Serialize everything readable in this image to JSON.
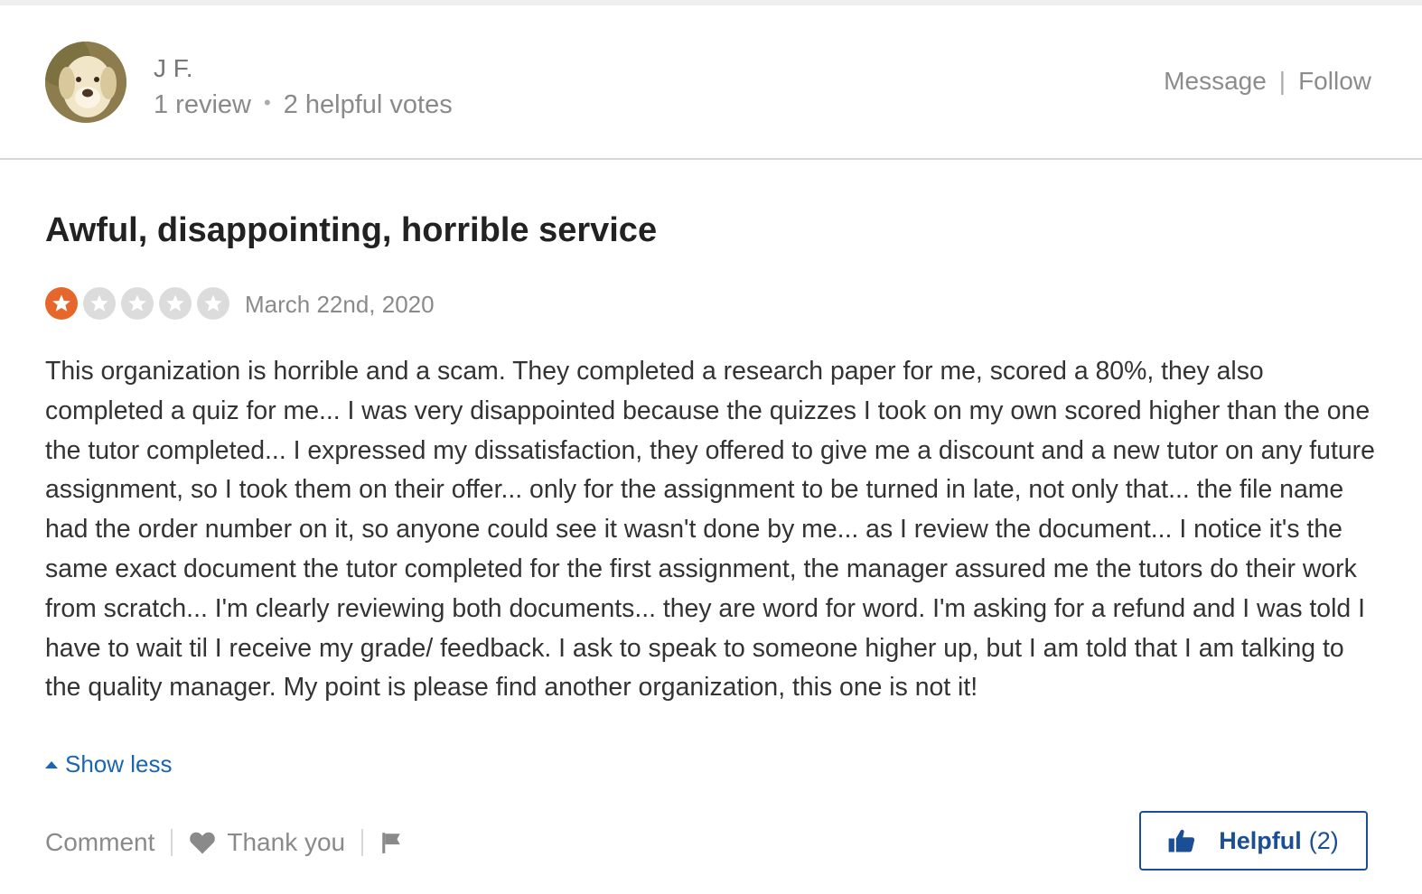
{
  "profile": {
    "name": "J F.",
    "review_count": "1 review",
    "helpful_votes": "2 helpful votes",
    "message_label": "Message",
    "separator": "|",
    "follow_label": "Follow"
  },
  "review": {
    "title": "Awful, disappointing, horrible service",
    "rating": 1,
    "rating_max": 5,
    "date": "March 22nd, 2020",
    "body": "This organization is horrible and a scam. They completed a research paper for me, scored a 80%, they also completed a quiz for me... I was very disappointed because the quizzes I took on my own scored higher than the one the tutor completed... I expressed my dissatisfaction, they offered to give me a discount and a new tutor on any future assignment, so I took them on their offer... only for the assignment to be turned in late, not only that... the file name had the order number on it, so anyone could see it wasn't done by me... as I review the document... I notice it's the same exact document the tutor completed for the first assignment, the manager assured me the tutors do their work from scratch... I'm clearly reviewing both documents... they are word for word. I'm asking for a refund and I was told I have to wait til I receive my grade/ feedback. I ask to speak to someone higher up, but I am told that I am talking to the quality manager. My point is please find another organization, this one is not it!",
    "show_less_label": "Show less"
  },
  "actions": {
    "comment_label": "Comment",
    "thank_label": "Thank you",
    "helpful_label": "Helpful",
    "helpful_count": "(2)"
  },
  "colors": {
    "star_active": "#e5672b",
    "star_inactive": "#dcdcdc",
    "link_blue": "#1a65b5",
    "button_blue": "#1a4f96"
  },
  "icons": {
    "avatar": "dog-avatar",
    "star": "star-icon",
    "heart": "heart-icon",
    "flag": "flag-icon",
    "thumbs_up": "thumbs-up-icon"
  }
}
